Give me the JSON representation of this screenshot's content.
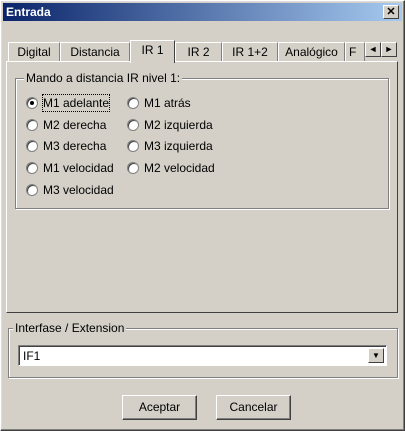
{
  "window": {
    "title": "Entrada",
    "close_glyph": "✕"
  },
  "tabs": [
    {
      "label": "Digital",
      "active": false
    },
    {
      "label": "Distancia",
      "active": false
    },
    {
      "label": "IR 1",
      "active": true
    },
    {
      "label": "IR 2",
      "active": false
    },
    {
      "label": "IR 1+2",
      "active": false
    },
    {
      "label": "Analógico",
      "active": false
    },
    {
      "label": "F",
      "active": false
    }
  ],
  "tab_scroll": {
    "left_icon": "◄",
    "right_icon": "►"
  },
  "ir_group": {
    "label": "Mando a distancia IR nivel 1:",
    "options": [
      {
        "label": "M1 adelante",
        "checked": true
      },
      {
        "label": "M1 atrás",
        "checked": false
      },
      {
        "label": "M2 derecha",
        "checked": false
      },
      {
        "label": "M2 izquierda",
        "checked": false
      },
      {
        "label": "M3 derecha",
        "checked": false
      },
      {
        "label": "M3 izquierda",
        "checked": false
      },
      {
        "label": "M1 velocidad",
        "checked": false
      },
      {
        "label": "M2 velocidad",
        "checked": false
      },
      {
        "label": "M3 velocidad",
        "checked": false
      }
    ]
  },
  "interface_group": {
    "label": "Interfase / Extension",
    "selected": "IF1",
    "dropdown_icon": "▼"
  },
  "buttons": {
    "ok": "Aceptar",
    "cancel": "Cancelar"
  }
}
